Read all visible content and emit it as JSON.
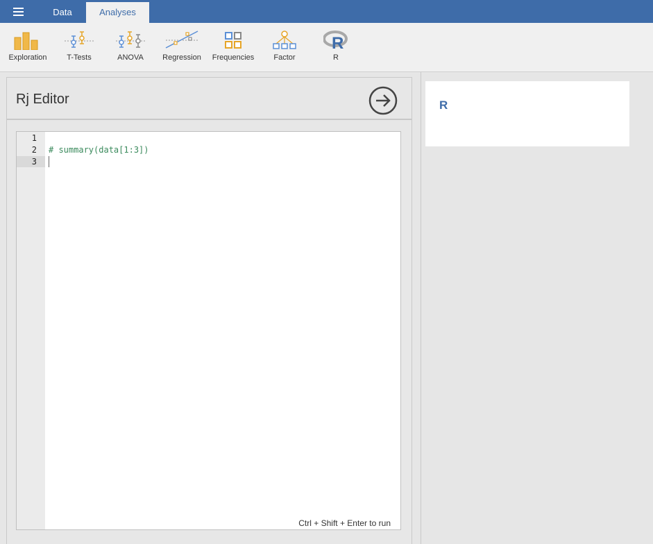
{
  "topbar": {
    "menu_icon": "hamburger-menu-icon",
    "tabs": [
      {
        "label": "Data",
        "active": false
      },
      {
        "label": "Analyses",
        "active": true
      }
    ],
    "accent_color": "#3e6ca9"
  },
  "ribbon": {
    "items": [
      {
        "label": "Exploration",
        "icon": "exploration-bar-icon"
      },
      {
        "label": "T-Tests",
        "icon": "ttests-icon"
      },
      {
        "label": "ANOVA",
        "icon": "anova-icon"
      },
      {
        "label": "Regression",
        "icon": "regression-icon"
      },
      {
        "label": "Frequencies",
        "icon": "frequencies-icon"
      },
      {
        "label": "Factor",
        "icon": "factor-icon"
      },
      {
        "label": "R",
        "icon": "r-logo-icon"
      }
    ]
  },
  "editor": {
    "title": "Rj Editor",
    "run_icon": "run-arrow-icon",
    "line_numbers": [
      "1",
      "2",
      "3"
    ],
    "lines": [
      "",
      "# summary(data[1:3])",
      ""
    ],
    "active_line": 3,
    "hint": "Ctrl + Shift + Enter to run"
  },
  "results": {
    "heading": "R"
  }
}
